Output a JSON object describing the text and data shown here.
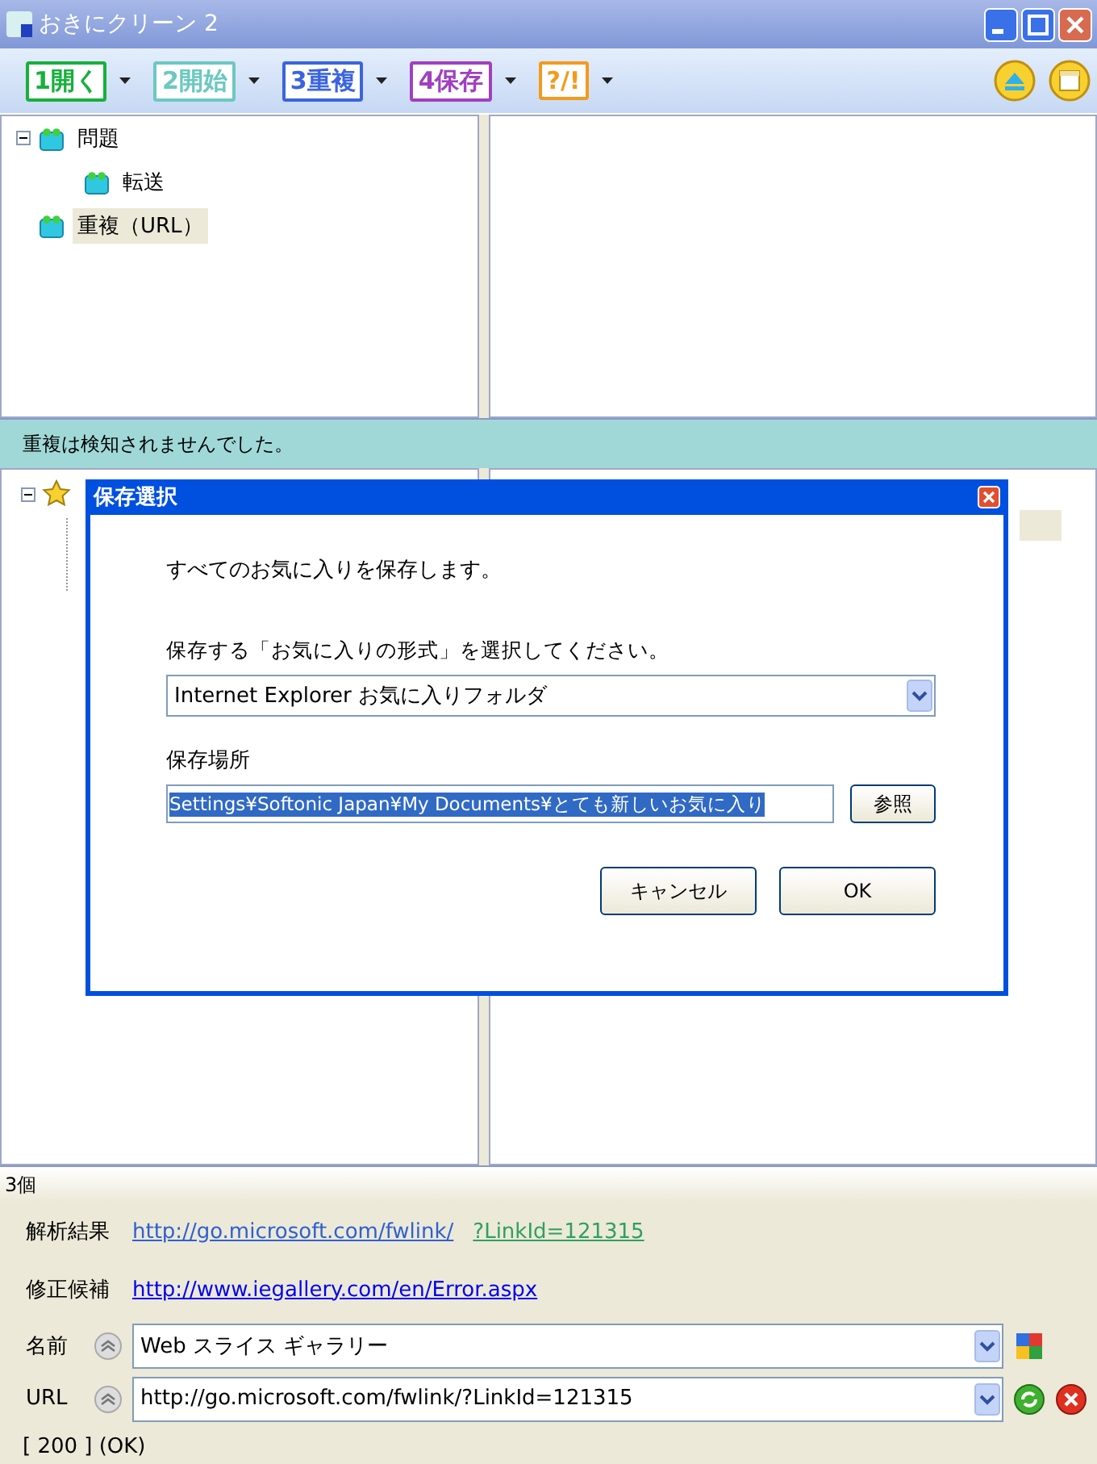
{
  "window": {
    "title": "おきにクリーン 2"
  },
  "toolbar": {
    "buttons": [
      {
        "label": "1開く",
        "color": "#18b03c"
      },
      {
        "label": "2開始",
        "color": "#6cc8c0"
      },
      {
        "label": "3重複",
        "color": "#3a64e0"
      },
      {
        "label": "4保存",
        "color": "#a040c0"
      },
      {
        "label": "?/!",
        "color": "#f49a1c"
      }
    ]
  },
  "top_tree": [
    {
      "label": "問題",
      "expanded": true,
      "selected": false,
      "children": [
        {
          "label": "転送",
          "selected": false
        }
      ]
    },
    {
      "label": "重複（URL）",
      "selected": true
    }
  ],
  "status_message": "重複は検知されませんでした。",
  "lower_tree": [
    {
      "expanded": true
    }
  ],
  "dialog": {
    "title": "保存選択",
    "intro": "すべてのお気に入りを保存します。",
    "format_label": "保存する「お気に入りの形式」を選択してください。",
    "format_value": "Internet Explorer お気に入りフォルダ",
    "location_label": "保存場所",
    "location_value": "Settings¥Softonic Japan¥My Documents¥とても新しいお気に入り",
    "location_highlighted": true,
    "browse_button": "参照",
    "cancel_button": "キャンセル",
    "ok_button": "OK"
  },
  "count": "3個",
  "details": {
    "analysis_label": "解析結果",
    "analysis_link": "http://go.microsoft.com/fwlink/",
    "analysis_link_extra": "?LinkId=121315",
    "suggestion_label": "修正候補",
    "suggestion_link": "http://www.iegallery.com/en/Error.aspx",
    "name_label": "名前",
    "name_value": "Web スライス ギャラリー",
    "url_label": "URL",
    "url_value": "http://go.microsoft.com/fwlink/?LinkId=121315",
    "response": "[ 200 ] (OK)"
  }
}
